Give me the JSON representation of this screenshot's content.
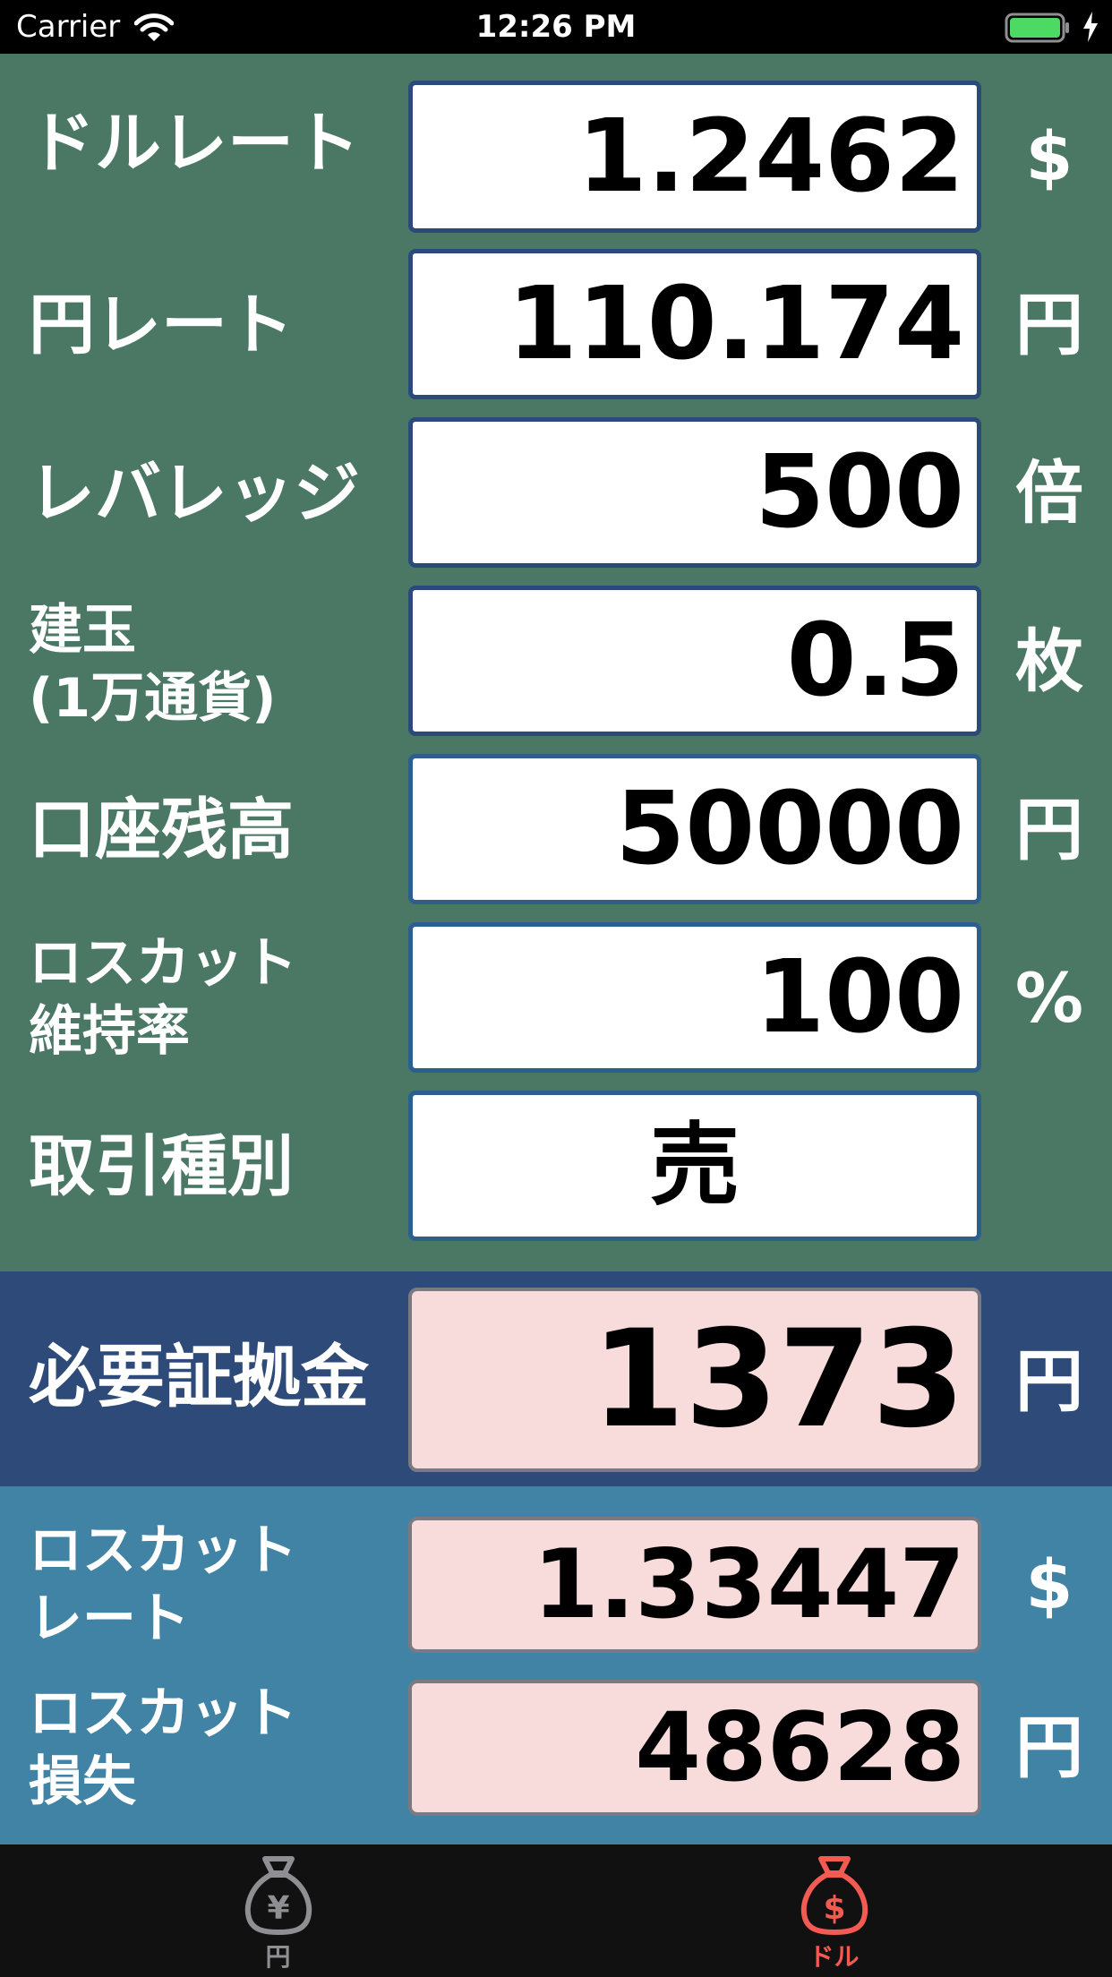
{
  "status_bar": {
    "carrier": "Carrier",
    "time": "12:26 PM",
    "battery_color": "#4cd964"
  },
  "form": {
    "dollar_rate": {
      "label": "ドルレート",
      "value": "1.2462",
      "unit": "$"
    },
    "yen_rate": {
      "label": "円レート",
      "value": "110.174",
      "unit": "円"
    },
    "leverage": {
      "label": "レバレッジ",
      "value": "500",
      "unit": "倍"
    },
    "position": {
      "label_line1": "建玉",
      "label_line2": "(1万通貨)",
      "value": "0.5",
      "unit": "枚"
    },
    "account_balance": {
      "label": "口座残高",
      "value": "50000",
      "unit": "円"
    },
    "losscut_ratio": {
      "label_line1": "ロスカット",
      "label_line2": "維持率",
      "value": "100",
      "unit": "%"
    },
    "trade_type": {
      "label": "取引種別",
      "value": "売"
    }
  },
  "results": {
    "required_margin": {
      "label": "必要証拠金",
      "value": "1373",
      "unit": "円"
    },
    "losscut_rate": {
      "label_line1": "ロスカット",
      "label_line2": "レート",
      "value": "1.33447",
      "unit": "$"
    },
    "losscut_loss": {
      "label_line1": "ロスカット",
      "label_line2": "損失",
      "value": "48628",
      "unit": "円"
    }
  },
  "colors": {
    "input_section_bg": "#4b7865",
    "margin_section_bg": "#2d4a78",
    "losscut_section_bg": "#4083a5",
    "result_field_bg": "#f8dbdb",
    "active_tab": "#f25a52",
    "inactive_tab": "#8e8e93"
  },
  "tab_bar": {
    "tabs": [
      {
        "label": "円",
        "icon": "yen-money-bag-icon",
        "active": false
      },
      {
        "label": "ドル",
        "icon": "dollar-money-bag-icon",
        "active": true
      }
    ]
  }
}
